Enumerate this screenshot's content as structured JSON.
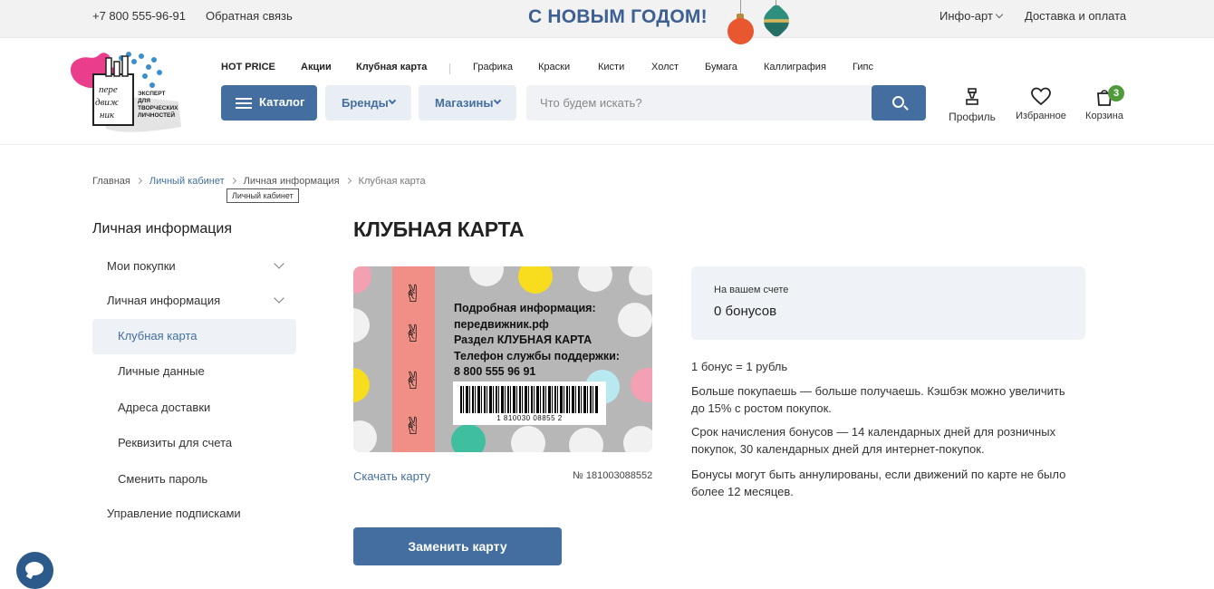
{
  "topbar": {
    "phone": "+7 800 555-96-91",
    "feedback": "Обратная связь",
    "banner": "С НОВЫМ ГОДОМ!",
    "info_art": "Инфо-арт",
    "delivery": "Доставка и оплата"
  },
  "logo": {
    "wordmark_1": "пере",
    "wordmark_2": "движ",
    "wordmark_3": "ник",
    "tagline_1": "ЭКСПЕРТ",
    "tagline_2": "ДЛЯ",
    "tagline_3": "ТВОРЧЕСКИХ",
    "tagline_4": "ЛИЧНОСТЕЙ"
  },
  "nav": {
    "hot_price": "HOT PRICE",
    "promo": "Акции",
    "club_card": "Клубная карта",
    "graphics": "Графика",
    "paints": "Краски",
    "brushes": "Кисти",
    "canvas": "Холст",
    "paper": "Бумага",
    "calligraphy": "Каллиграфия",
    "gypsum": "Гипс"
  },
  "header": {
    "catalog": "Каталог",
    "brands": "Бренды",
    "stores": "Магазины",
    "search_placeholder": "Что будем искать?",
    "profile": "Профиль",
    "favorites": "Избранное",
    "cart": "Корзина",
    "cart_count": "3"
  },
  "breadcrumb": {
    "home": "Главная",
    "account": "Личный кабинет",
    "personal": "Личная информация",
    "current": "Клубная карта",
    "tooltip": "Личный кабинет"
  },
  "sidebar": {
    "title": "Личная информация",
    "items": [
      {
        "label": "Мои покупки"
      },
      {
        "label": "Личная информация"
      },
      {
        "label": "Клубная карта"
      },
      {
        "label": "Личные данные"
      },
      {
        "label": "Адреса доставки"
      },
      {
        "label": "Реквизиты для счета"
      },
      {
        "label": "Сменить пароль"
      },
      {
        "label": "Управление подписками"
      }
    ]
  },
  "main": {
    "title": "КЛУБНАЯ КАРТА",
    "card": {
      "line1": "Подробная информация:",
      "line2": "передвижник.рф",
      "line3": "Раздел КЛУБНАЯ КАРТА",
      "line4": "Телефон службы поддержки:",
      "line5": "8 800 555 96 91",
      "barcode_number": "1 810030 08855 2"
    },
    "download": "Скачать карту",
    "card_number": "№ 181003088552",
    "replace_button": "Заменить карту",
    "balance_caption": "На вашем счете",
    "balance_value": "0 бонусов",
    "rate": "1 бонус = 1 рубль",
    "cashback": "Больше покупаешь — больше получаешь. Кэшбэк можно увеличить до 15% с ростом покупок.",
    "accrual": "Срок начисления бонусов — 14 календарных дней для розничных покупок, 30 календарных дней для интернет-покупок.",
    "expiry": "Бонусы могут быть аннулированы, если движений по карте не было более 12 месяцев."
  },
  "colors": {
    "accent": "#436e9f",
    "banner": "#3d5f91",
    "badge": "#4f9a3a"
  },
  "icons": {
    "chat": "chat-icon",
    "search": "search-icon",
    "profile": "profile-icon",
    "favorites": "heart-icon",
    "cart": "cart-icon"
  }
}
